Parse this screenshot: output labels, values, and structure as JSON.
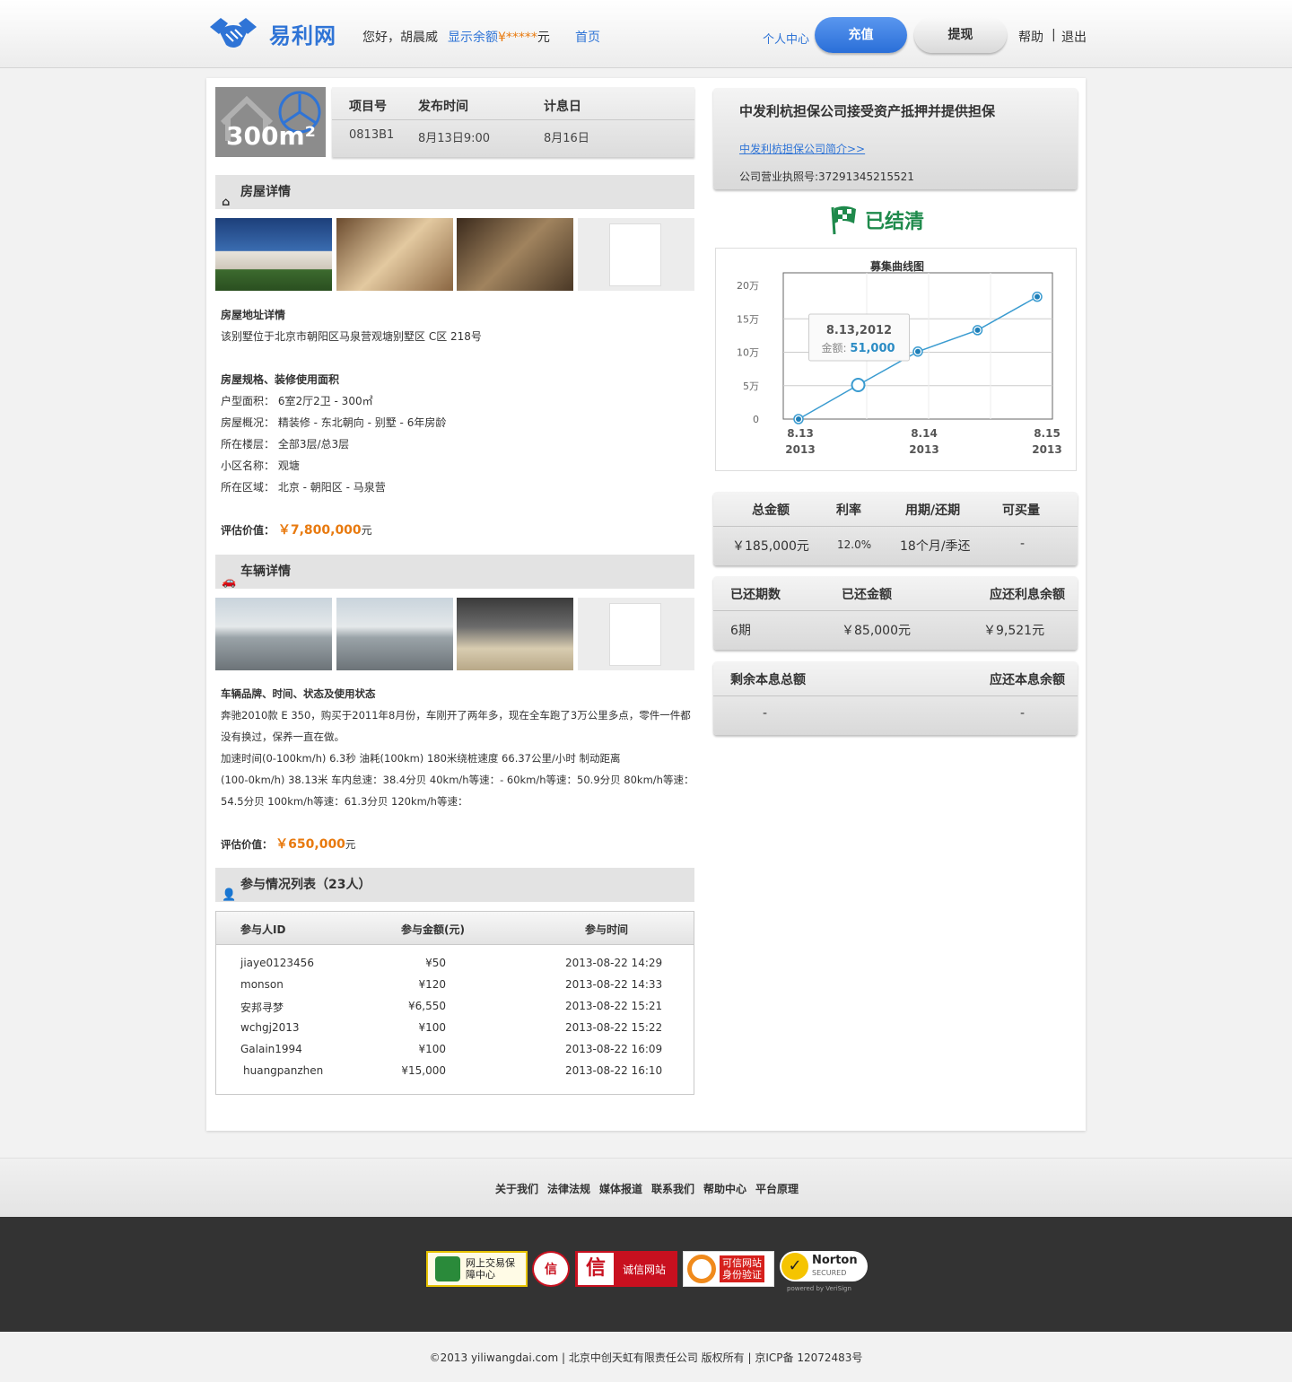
{
  "header": {
    "logo_text": "易利网",
    "greeting": "您好，胡晨威",
    "balance_label": "显示余额",
    "balance_currency": "¥",
    "balance_masked": "*****",
    "balance_unit": "元",
    "home": "首页",
    "user_center": "个人中心",
    "recharge": "充值",
    "withdraw": "提现",
    "help": "帮助",
    "separator": "|",
    "logout": "退出"
  },
  "project": {
    "thumb_area": "300m²",
    "headers": [
      "项目号",
      "发布时间",
      "计息日"
    ],
    "values": [
      "0813B1",
      "8月13日9:00",
      "8月16日"
    ]
  },
  "house": {
    "section_title": "房屋详情",
    "address_title": "房屋地址详情",
    "address": "该别墅位于北京市朝阳区马泉营观塘别墅区 C区 218号",
    "spec_title": "房屋规格、装修使用面积",
    "specs": [
      "户型面积：  6室2厅2卫 - 300㎡",
      "房屋概况：  精装修 - 东北朝向 - 别墅 - 6年房龄",
      "所在楼层：  全部3层/总3层",
      "小区名称：  观塘",
      "所在区域：  北京 - 朝阳区 - 马泉营"
    ],
    "value_label": "评估价值：",
    "value": "￥7,800,000",
    "value_unit": "元"
  },
  "car": {
    "section_title": "车辆详情",
    "title": "车辆品牌、时间、状态及使用状态",
    "lines": [
      "奔驰2010款 E 350，购买于2011年8月份，车刚开了两年多，现在全车跑了3万公里多点，零件一件都",
      "没有换过，保养一直在做。",
      "加速时间(0-100km/h)      6.3秒   油耗(100km)   180米绕桩速度     66.37公里/小时        制动距离",
      "(100-0km/h) 38.13米     车内怠速：38.4分贝 40km/h等速：- 60km/h等速：50.9分贝 80km/h等速：",
      "54.5分贝 100km/h等速：61.3分贝 120km/h等速："
    ],
    "value_label": "评估价值：",
    "value": "￥650,000",
    "value_unit": "元"
  },
  "participants": {
    "section_title": "参与情况列表（23人）",
    "headers": [
      "参与人ID",
      "参与金额(元)",
      "参与时间"
    ],
    "rows": [
      [
        "jiaye0123456",
        "¥50",
        "2013-08-22 14:29"
      ],
      [
        "monson",
        "¥120",
        "2013-08-22 14:33"
      ],
      [
        "安邦寻梦",
        "¥6,550",
        "2013-08-22 15:21"
      ],
      [
        "wchgj2013",
        "¥100",
        "2013-08-22 15:22"
      ],
      [
        "Galain1994",
        "¥100",
        "2013-08-22 16:09"
      ],
      [
        "huangpanzhen",
        "¥15,000",
        "2013-08-22 16:10"
      ]
    ]
  },
  "guarantee": {
    "title": "中发利杭担保公司接受资产抵押并提供担保",
    "link": "中发利杭担保公司简介>>",
    "license": "公司营业执照号:37291345215521"
  },
  "status": {
    "text": "已结清",
    "color": "#1f8a4c"
  },
  "chart_data": {
    "type": "line",
    "title": "募集曲线图",
    "y_ticks": [
      "20万",
      "15万",
      "10万",
      "5万",
      "0"
    ],
    "ylim": [
      0,
      200000
    ],
    "x_ticks": [
      [
        "8.13",
        "2013"
      ],
      [
        "8.14",
        "2013"
      ],
      [
        "8.15",
        "2013"
      ]
    ],
    "series": [
      {
        "values": [
          0,
          51000,
          101000,
          133000,
          183000
        ]
      }
    ],
    "tooltip": {
      "date": "8.13,2012",
      "label": "金额:",
      "value": "51,000"
    },
    "color": "#3a9bd0",
    "grid": true
  },
  "stats1": {
    "headers": [
      "总金额",
      "利率",
      "用期/还期",
      "可买量"
    ],
    "values": [
      "￥185,000元",
      "12.0%",
      "18个月/季还",
      "-"
    ]
  },
  "stats2": {
    "headers": [
      "已还期数",
      "已还金额",
      "应还利息余额"
    ],
    "values": [
      "6期",
      "￥85,000元",
      "￥9,521元"
    ]
  },
  "stats3": {
    "headers": [
      "剩余本息总额",
      "应还本息余额"
    ],
    "values": [
      "-",
      "-"
    ]
  },
  "footer": {
    "links": [
      "关于我们",
      "法律法规",
      "媒体报道",
      "联系我们",
      "帮助中心",
      "平台原理"
    ],
    "badges": {
      "b1": "网上交易保障中心",
      "b2": "信",
      "b3": "诚信网站",
      "b4": "可信网站",
      "b4_sub": "身份验证",
      "b5": "Norton",
      "b5_sub": "SECURED",
      "b5_by": "powered by VeriSign"
    },
    "copyright": "©2013 yiliwangdai.com | 北京中创天虹有限责任公司 版权所有 | 京ICP备 12072483号"
  }
}
